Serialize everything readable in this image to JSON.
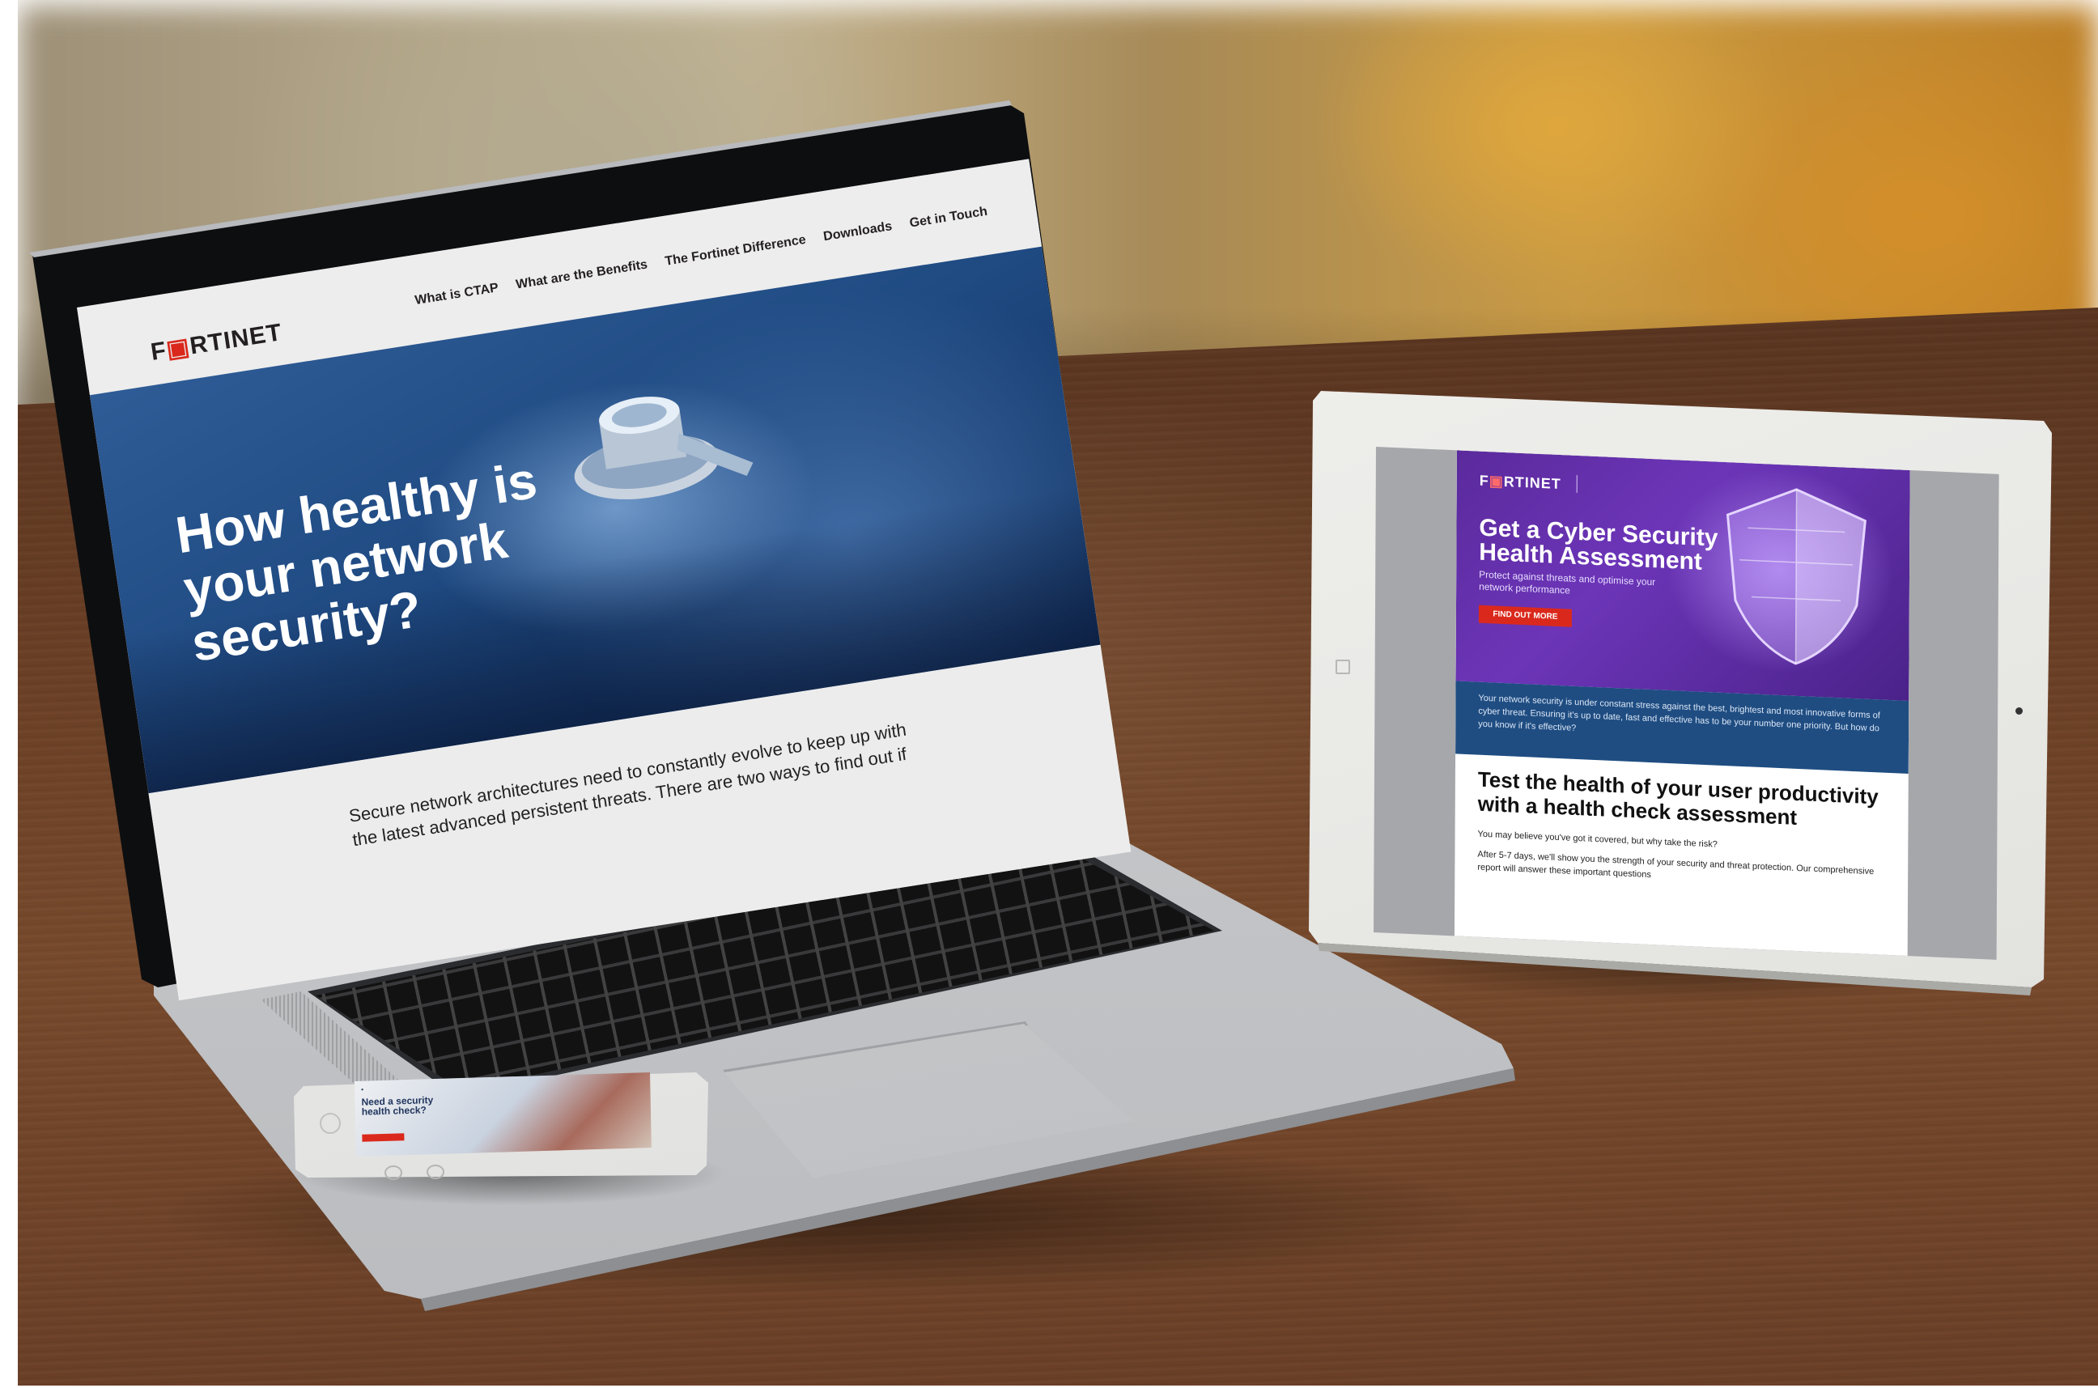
{
  "laptop": {
    "logo": "F",
    "logo_red": "▣",
    "logo_rest": "RTINET",
    "nav": [
      "What is CTAP",
      "What are the Benefits",
      "The Fortinet Difference",
      "Downloads",
      "Get in Touch"
    ],
    "hero_title": "How healthy is your network security?",
    "intro": "Secure network architectures need to constantly evolve to keep up with the latest advanced persistent threats. There are two ways to find out if"
  },
  "tablet": {
    "logo": "F",
    "logo_red": "▣",
    "logo_rest": "RTINET",
    "title": "Get a Cyber Security Health Assessment",
    "subtitle": "Protect against threats and optimise your network performance",
    "cta": "FIND OUT MORE",
    "band_text": "Your network security is under constant stress against the best, brightest and most innovative forms of cyber threat. Ensuring it's up to date, fast and effective has to be your number one priority. But how do you know if it's effective?",
    "heading": "Test the health of your user productivity with a health check assessment",
    "p1": "You may believe you've got it covered, but why take the risk?",
    "p2": "After 5-7 days, we'll show you the strength of your security and threat protection. Our comprehensive report will answer these important questions"
  },
  "phone": {
    "title": "Need a security health check?"
  },
  "colors": {
    "fortinet_red": "#da291c",
    "hero_blue": "#1f4a82",
    "email_purple": "#5b2a9c",
    "band_blue": "#1f4d82"
  }
}
